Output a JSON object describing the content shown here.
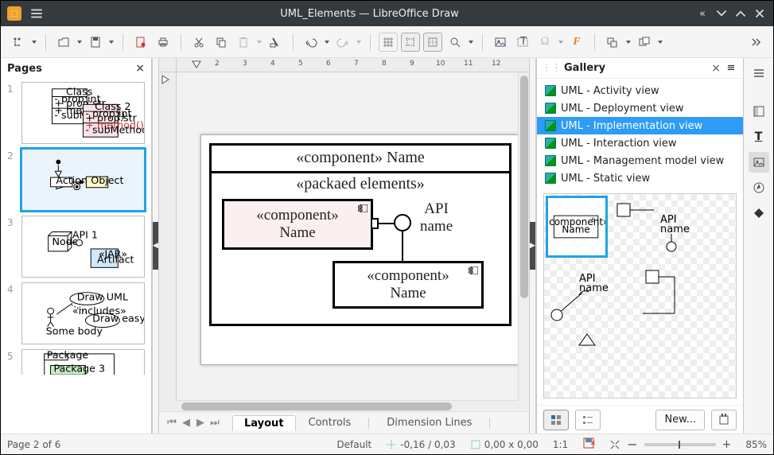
{
  "title": "UML_Elements — LibreOffice Draw",
  "pagesPanel": {
    "title": "Pages",
    "pages": [
      "1",
      "2",
      "3",
      "4",
      "5"
    ],
    "selected": 2
  },
  "ruler_h": [
    2,
    3,
    4,
    5,
    6,
    7,
    8,
    9,
    10,
    11,
    12
  ],
  "diagram": {
    "outer_title": "«component» Name",
    "packaged_title": "«packaed elements»",
    "inner_component": "«component»\nName",
    "api": "API\nname",
    "inner_component2": "«component»\nName"
  },
  "gallery": {
    "title": "Gallery",
    "items": [
      "UML - Activity view",
      "UML - Deployment view",
      "UML - Implementation view",
      "UML - Interaction view",
      "UML - Management model view",
      "UML - Static view"
    ],
    "selected": 2,
    "new": "New...",
    "thumb_api": "API\nname",
    "thumb_comp": "«component»\nName"
  },
  "tabs": {
    "tabs": [
      "Layout",
      "Controls",
      "Dimension Lines"
    ],
    "active": 0
  },
  "status": {
    "page": "Page 2 of 6",
    "style": "Default",
    "coords": "-0,16 / 0,03",
    "size": "0,00 x 0,00",
    "scale": "1:1",
    "zoom": "85%"
  }
}
